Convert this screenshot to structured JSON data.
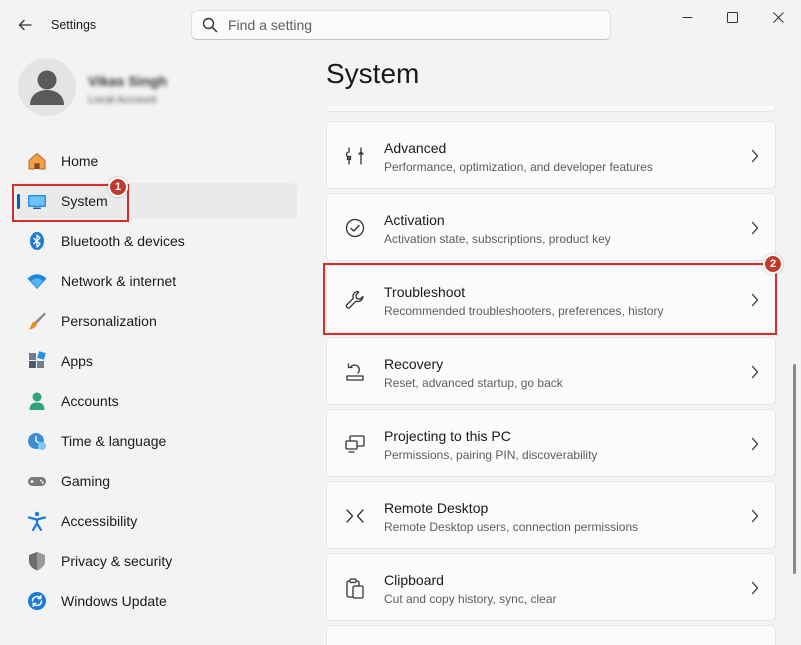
{
  "window": {
    "title": "Settings",
    "controls": {
      "minimize": "minimize-icon",
      "maximize": "maximize-icon",
      "close": "close-icon"
    }
  },
  "search": {
    "placeholder": "Find a setting",
    "value": ""
  },
  "profile": {
    "name": "Vikas Singh",
    "account_type": "Local Account"
  },
  "nav": {
    "items": [
      {
        "label": "Home",
        "icon": "home-icon"
      },
      {
        "label": "System",
        "icon": "system-icon",
        "active": true
      },
      {
        "label": "Bluetooth & devices",
        "icon": "bluetooth-icon"
      },
      {
        "label": "Network & internet",
        "icon": "wifi-icon"
      },
      {
        "label": "Personalization",
        "icon": "brush-icon"
      },
      {
        "label": "Apps",
        "icon": "apps-icon"
      },
      {
        "label": "Accounts",
        "icon": "accounts-icon"
      },
      {
        "label": "Time & language",
        "icon": "time-language-icon"
      },
      {
        "label": "Gaming",
        "icon": "gaming-icon"
      },
      {
        "label": "Accessibility",
        "icon": "accessibility-icon"
      },
      {
        "label": "Privacy & security",
        "icon": "shield-icon"
      },
      {
        "label": "Windows Update",
        "icon": "update-icon"
      }
    ]
  },
  "main": {
    "title": "System",
    "cards": [
      {
        "title": "Advanced",
        "subtitle": "Performance, optimization, and developer features",
        "icon": "tools-icon"
      },
      {
        "title": "Activation",
        "subtitle": "Activation state, subscriptions, product key",
        "icon": "check-circle-icon"
      },
      {
        "title": "Troubleshoot",
        "subtitle": "Recommended troubleshooters, preferences, history",
        "icon": "wrench-icon"
      },
      {
        "title": "Recovery",
        "subtitle": "Reset, advanced startup, go back",
        "icon": "recovery-icon"
      },
      {
        "title": "Projecting to this PC",
        "subtitle": "Permissions, pairing PIN, discoverability",
        "icon": "projecting-icon"
      },
      {
        "title": "Remote Desktop",
        "subtitle": "Remote Desktop users, connection permissions",
        "icon": "remote-desktop-icon"
      },
      {
        "title": "Clipboard",
        "subtitle": "Cut and copy history, sync, clear",
        "icon": "clipboard-icon"
      }
    ]
  },
  "annotations": {
    "step1": "1",
    "step2": "2",
    "highlight_color": "#d32f2f"
  },
  "colors": {
    "accent": "#005fb8",
    "background": "#f3f3f3",
    "card": "#fbfbfb"
  }
}
